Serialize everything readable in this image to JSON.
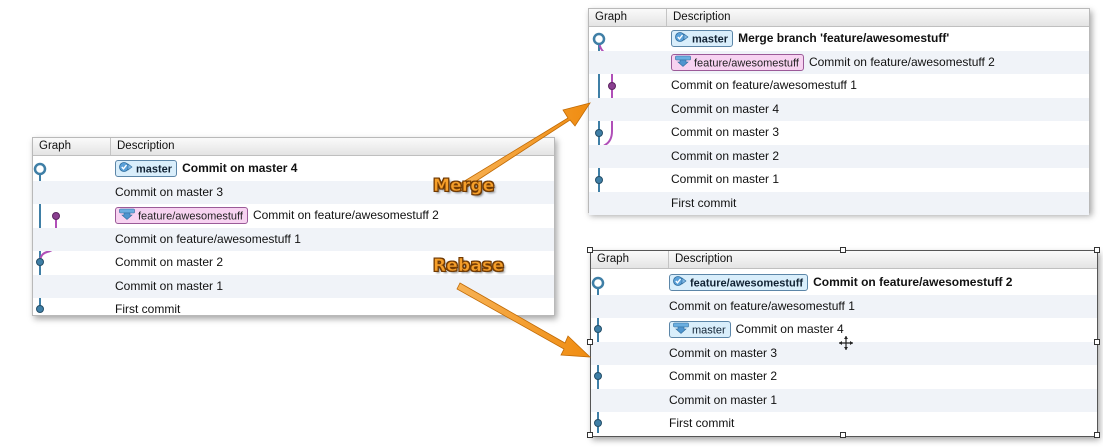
{
  "columns": {
    "graph": "Graph",
    "description": "Description"
  },
  "colors": {
    "master_line": "#3f7fa6",
    "feature_line": "#b04fb8",
    "node_fill": "#3f7fa6",
    "feature_node_fill": "#8a3f90",
    "callout": "#f6a02a",
    "arrow": "#f39a1c"
  },
  "original": {
    "rows": [
      {
        "badge": "master",
        "badge_type": "master",
        "badge_icon": "checkmark-branch-icon",
        "text": "Commit on master 4",
        "bold": true
      },
      {
        "text": "Commit on master 3"
      },
      {
        "badge": "feature/awesomestuff",
        "badge_type": "feature",
        "badge_icon": "download-arrow-icon",
        "text": "Commit on feature/awesomestuff 2"
      },
      {
        "text": "Commit on feature/awesomestuff 1"
      },
      {
        "text": "Commit on master 2"
      },
      {
        "text": "Commit on master 1"
      },
      {
        "text": "First commit"
      }
    ]
  },
  "merge": {
    "label": "Merge",
    "rows": [
      {
        "badge": "master",
        "badge_type": "master",
        "badge_icon": "checkmark-branch-icon",
        "text": "Merge branch 'feature/awesomestuff'",
        "bold": true
      },
      {
        "badge": "feature/awesomestuff",
        "badge_type": "feature",
        "badge_icon": "download-arrow-icon",
        "text": "Commit on feature/awesomestuff 2"
      },
      {
        "text": "Commit on feature/awesomestuff 1"
      },
      {
        "text": "Commit on master 4"
      },
      {
        "text": "Commit on master 3"
      },
      {
        "text": "Commit on master 2"
      },
      {
        "text": "Commit on master 1"
      },
      {
        "text": "First commit"
      }
    ]
  },
  "rebase": {
    "label": "Rebase",
    "rows": [
      {
        "badge": "feature/awesomestuff",
        "badge_type": "master",
        "badge_icon": "checkmark-branch-icon",
        "text": "Commit on feature/awesomestuff 2",
        "bold": true
      },
      {
        "text": "Commit on feature/awesomestuff 1"
      },
      {
        "badge": "master",
        "badge_type": "master",
        "badge_icon": "download-arrow-icon",
        "text": "Commit on master 4"
      },
      {
        "text": "Commit on master 3"
      },
      {
        "text": "Commit on master 2"
      },
      {
        "text": "Commit on master 1"
      },
      {
        "text": "First commit"
      }
    ]
  }
}
